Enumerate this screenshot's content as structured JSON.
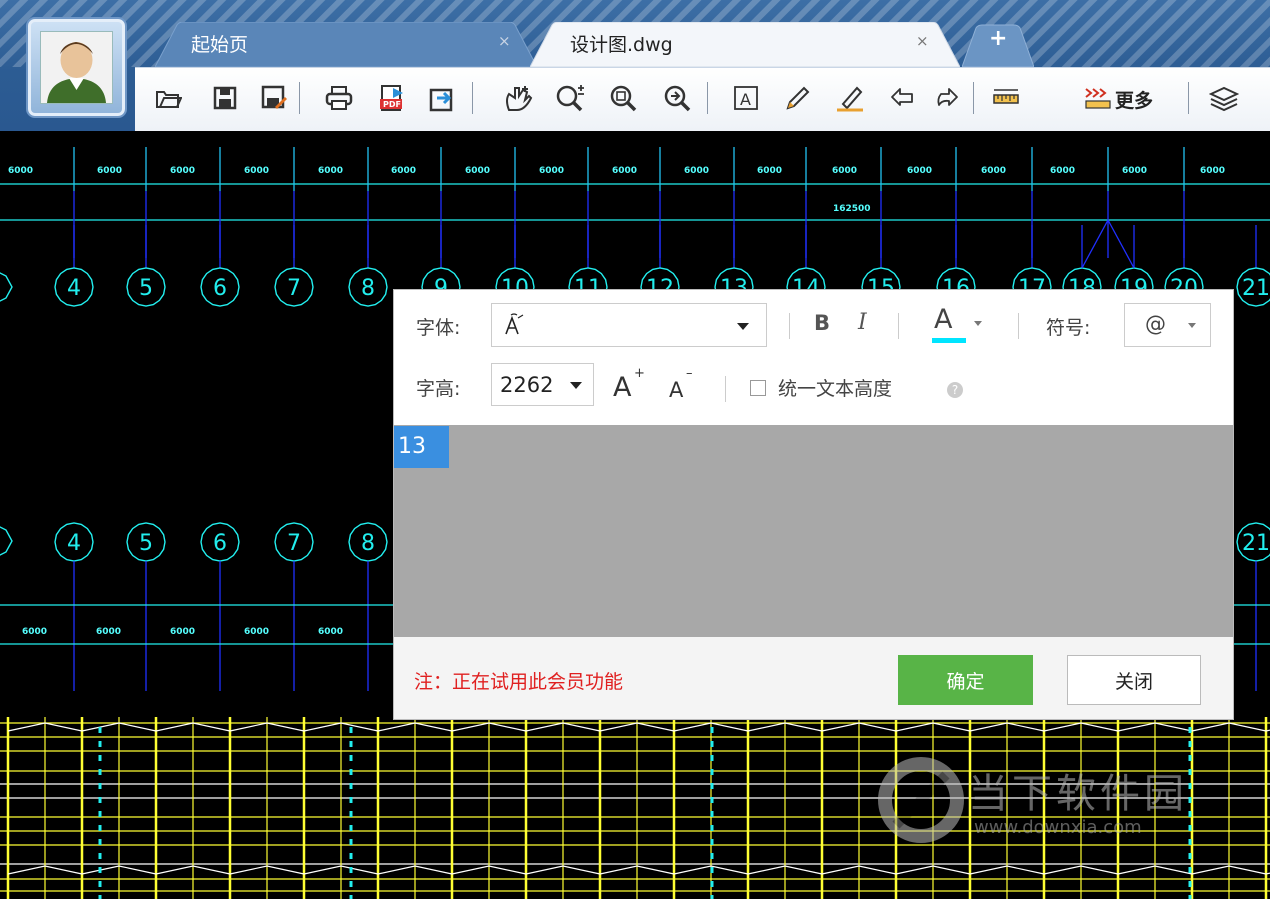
{
  "tabs": [
    {
      "title": "起始页",
      "close": "×",
      "active": false
    },
    {
      "title": "设计图.dwg",
      "close": "×",
      "active": true
    }
  ],
  "new_tab_label": "+",
  "toolbar": {
    "icons": [
      "open-folder-icon",
      "save-icon",
      "save-as-icon",
      "print-icon",
      "export-pdf-icon",
      "export-image-icon",
      "convert-icon",
      "pan-hand-icon",
      "zoom-in-out-icon",
      "zoom-window-icon",
      "zoom-extents-icon",
      "text-tool-icon",
      "pencil-icon",
      "highlighter-icon",
      "undo-icon",
      "redo-icon",
      "measure-ruler-icon",
      "measure-more-icon",
      "layers-icon"
    ],
    "more_label": "更多"
  },
  "cad": {
    "top_dims": [
      "6000",
      "6000",
      "6000",
      "6000",
      "6000",
      "6000",
      "6000",
      "6000",
      "6000",
      "6000",
      "6000",
      "6000",
      "6000",
      "6000",
      "6000",
      "6000",
      "6000"
    ],
    "total_dim": "162500",
    "axis_labels_top": [
      "4",
      "5",
      "6",
      "7",
      "8",
      "9",
      "10",
      "11",
      "12",
      "13",
      "14",
      "15",
      "16",
      "17",
      "18",
      "19",
      "20",
      "21"
    ],
    "axis_labels_bottom": [
      "4",
      "5",
      "6",
      "7",
      "8",
      "21"
    ],
    "bottom_dims": [
      "6000",
      "6000",
      "6000",
      "6000",
      "6000"
    ]
  },
  "dialog": {
    "font_label": "字体:",
    "font_value": "",
    "bold_label": "B",
    "italic_label": "I",
    "color_label": "A",
    "color_underline": "#00e5ff",
    "symbol_label": "符号:",
    "symbol_value": "@",
    "height_label": "字高:",
    "height_value": "2262",
    "increase_font_label": "A",
    "decrease_font_label": "A",
    "uniform_height_label": "统一文本高度",
    "edit_text": "13",
    "trial_note": "注：正在试用此会员功能",
    "ok_label": "确定",
    "close_label": "关闭"
  },
  "watermark": {
    "title": "当下软件园",
    "url": "www.downxia.com"
  },
  "colors": {
    "accent_green": "#58b447",
    "cad_cyan": "#2ee",
    "cad_blue": "#2030ff",
    "cad_yellow": "#ffff33"
  }
}
